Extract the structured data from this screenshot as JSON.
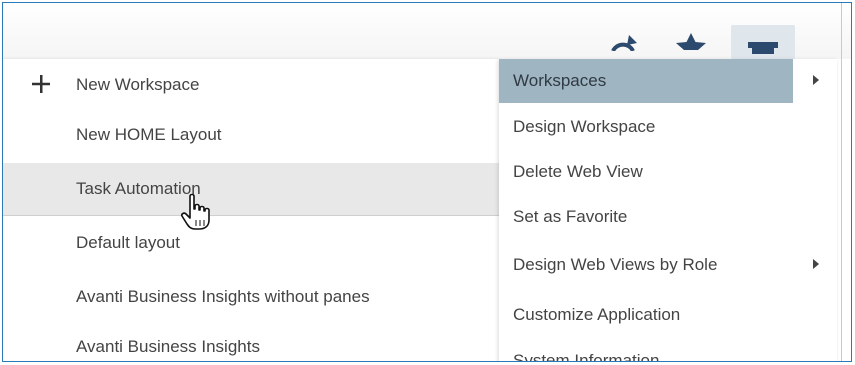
{
  "toolbar": {
    "icons": [
      "refresh-icon",
      "star-icon",
      "gear-icon"
    ],
    "icon_color": "#2b4a6e",
    "gear_active_bg": "#dfe6ec"
  },
  "workspace_menu": {
    "items": [
      {
        "label": "New Workspace",
        "icon": "plus-icon"
      },
      {
        "label": "New HOME Layout"
      },
      {
        "label": "Task Automation",
        "hovered": true
      },
      {
        "label": "Default layout"
      },
      {
        "label": "Avanti Business Insights without panes"
      },
      {
        "label": "Avanti Business Insights"
      }
    ],
    "hover_color": "#e8e8e8"
  },
  "settings_menu": {
    "items": [
      {
        "label": "Workspaces",
        "active": true,
        "has_submenu": true
      },
      {
        "label": "Design Workspace"
      },
      {
        "label": "Delete Web View"
      },
      {
        "label": "Set as Favorite"
      },
      {
        "label": "Design Web Views by Role",
        "has_submenu": true
      },
      {
        "label": "Customize Application"
      },
      {
        "label": "System Information"
      }
    ],
    "active_color": "#9fb5c1"
  },
  "colors": {
    "frame_border": "#2a7ab8",
    "text": "#444444"
  }
}
